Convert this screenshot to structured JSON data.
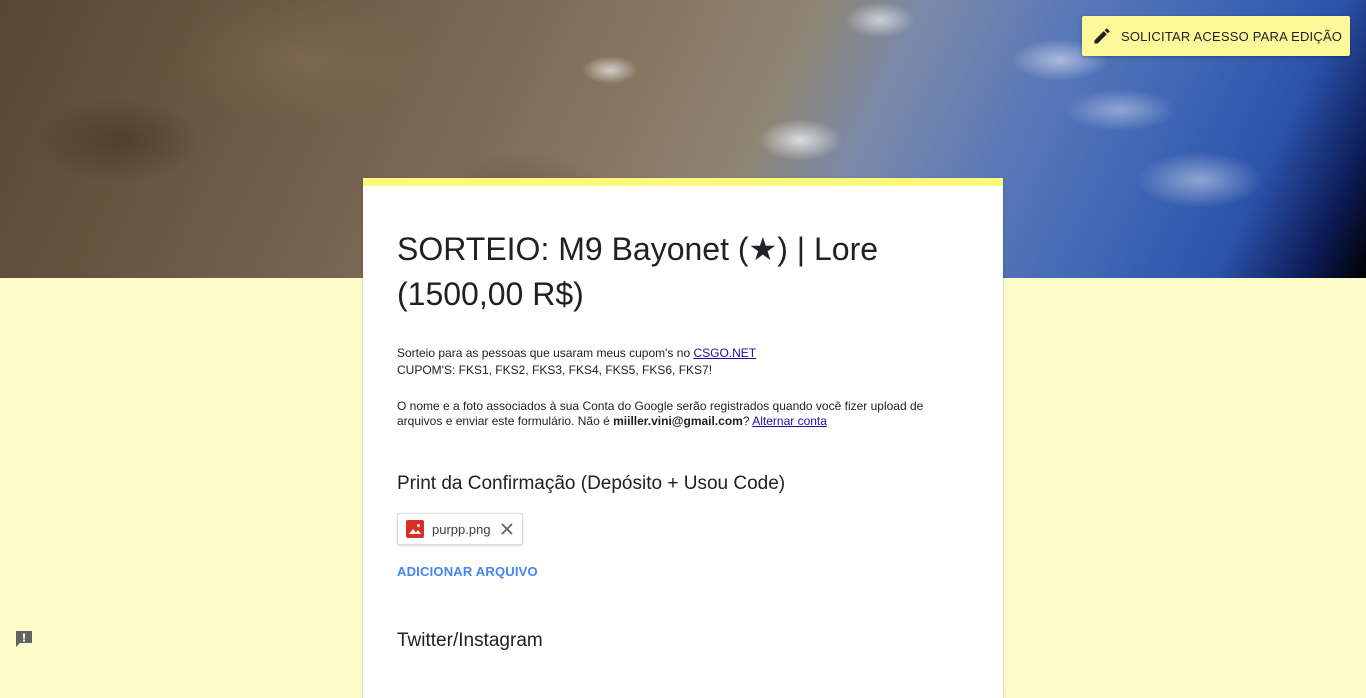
{
  "header": {
    "edit_request_label": "SOLICITAR ACESSO PARA EDIÇÃO"
  },
  "form": {
    "title": "SORTEIO: M9 Bayonet (★) | Lore (1500,00 R$)",
    "description_line1_prefix": "Sorteio para as pessoas que usaram meus cupom's no ",
    "description_link": "CSGO.NET",
    "description_line2": "CUPOM'S: FKS1, FKS2, FKS3, FKS4, FKS5, FKS6, FKS7!",
    "notice_prefix": "O nome e a foto associados à sua Conta do Google serão registrados quando você fizer upload de arquivos e enviar este formulário. Não é ",
    "notice_email": "miiller.vini@gmail.com",
    "notice_question": "? ",
    "notice_switch_link": "Alternar conta"
  },
  "questions": [
    {
      "title": "Print da Confirmação (Depósito + Usou Code)",
      "file_name": "purpp.png",
      "add_file_label": "ADICIONAR ARQUIVO"
    },
    {
      "title": "Twitter/Instagram"
    }
  ],
  "icons": {
    "edit": "pencil-icon",
    "file": "image-file-icon",
    "remove": "close-icon",
    "report": "report-problem-icon"
  },
  "colors": {
    "background": "#fefcc8",
    "accent": "#fbf97d",
    "edit_button": "#fdf99b",
    "link": "#4285f4"
  }
}
